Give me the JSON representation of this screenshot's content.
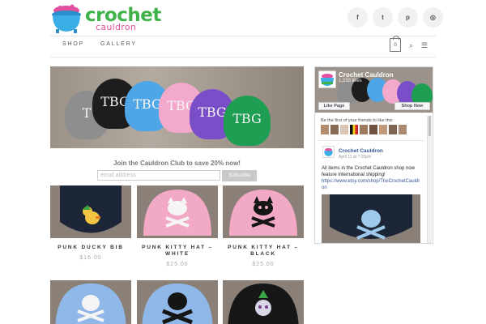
{
  "brand": {
    "word1": "crochet",
    "word2": "cauldron",
    "colors": {
      "green": "#3fb24a",
      "pink": "#e2509f",
      "blue": "#3aaee5"
    }
  },
  "social": [
    {
      "icon": "facebook-icon",
      "glyph": "f"
    },
    {
      "icon": "twitter-icon",
      "glyph": "t"
    },
    {
      "icon": "pinterest-icon",
      "glyph": "p"
    },
    {
      "icon": "instagram-icon",
      "glyph": "◎"
    }
  ],
  "nav": {
    "items": [
      "SHOP",
      "GALLERY"
    ]
  },
  "cart": {
    "count": "0"
  },
  "club": {
    "title": "Join the Cauldron Club to save 20% now!",
    "email_placeholder": "email address",
    "subscribe_label": "Subscribe"
  },
  "products": [
    {
      "name": "PUNK DUCKY BIB",
      "price": "$16.00"
    },
    {
      "name": "PUNK KITTY HAT – WHITE",
      "price": "$25.00"
    },
    {
      "name": "PUNK KITTY HAT – BLACK",
      "price": "$25.00"
    },
    {
      "name": "",
      "price": ""
    },
    {
      "name": "",
      "price": ""
    },
    {
      "name": "",
      "price": ""
    }
  ],
  "facebook": {
    "page_name": "Crochet Cauldron",
    "likes": "1,233 likes",
    "like_button": "Like Page",
    "shop_button": "Shop Now",
    "friends_text": "Be the first of your friends to like this",
    "post": {
      "author": "Crochet Cauldron",
      "date": "April 11 at 7:20pm",
      "text": "All items in the Crochet Cauldron shop now feature international shipping!",
      "link": "https://www.etsy.com/shop/TheCrochetCauldron"
    }
  }
}
